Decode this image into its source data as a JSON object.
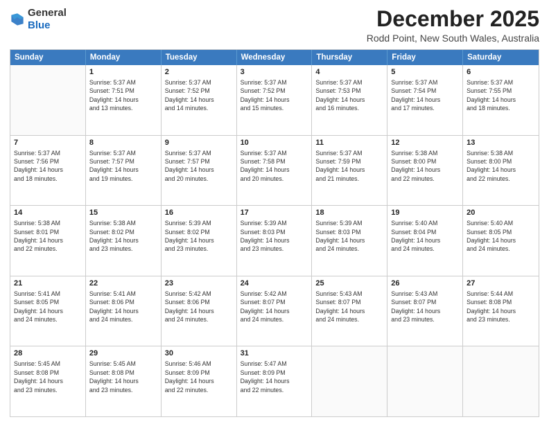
{
  "logo": {
    "general": "General",
    "blue": "Blue"
  },
  "header": {
    "month": "December 2025",
    "location": "Rodd Point, New South Wales, Australia"
  },
  "days": [
    "Sunday",
    "Monday",
    "Tuesday",
    "Wednesday",
    "Thursday",
    "Friday",
    "Saturday"
  ],
  "weeks": [
    [
      {
        "day": "",
        "content": ""
      },
      {
        "day": "1",
        "content": "Sunrise: 5:37 AM\nSunset: 7:51 PM\nDaylight: 14 hours\nand 13 minutes."
      },
      {
        "day": "2",
        "content": "Sunrise: 5:37 AM\nSunset: 7:52 PM\nDaylight: 14 hours\nand 14 minutes."
      },
      {
        "day": "3",
        "content": "Sunrise: 5:37 AM\nSunset: 7:52 PM\nDaylight: 14 hours\nand 15 minutes."
      },
      {
        "day": "4",
        "content": "Sunrise: 5:37 AM\nSunset: 7:53 PM\nDaylight: 14 hours\nand 16 minutes."
      },
      {
        "day": "5",
        "content": "Sunrise: 5:37 AM\nSunset: 7:54 PM\nDaylight: 14 hours\nand 17 minutes."
      },
      {
        "day": "6",
        "content": "Sunrise: 5:37 AM\nSunset: 7:55 PM\nDaylight: 14 hours\nand 18 minutes."
      }
    ],
    [
      {
        "day": "7",
        "content": "Sunrise: 5:37 AM\nSunset: 7:56 PM\nDaylight: 14 hours\nand 18 minutes."
      },
      {
        "day": "8",
        "content": "Sunrise: 5:37 AM\nSunset: 7:57 PM\nDaylight: 14 hours\nand 19 minutes."
      },
      {
        "day": "9",
        "content": "Sunrise: 5:37 AM\nSunset: 7:57 PM\nDaylight: 14 hours\nand 20 minutes."
      },
      {
        "day": "10",
        "content": "Sunrise: 5:37 AM\nSunset: 7:58 PM\nDaylight: 14 hours\nand 20 minutes."
      },
      {
        "day": "11",
        "content": "Sunrise: 5:37 AM\nSunset: 7:59 PM\nDaylight: 14 hours\nand 21 minutes."
      },
      {
        "day": "12",
        "content": "Sunrise: 5:38 AM\nSunset: 8:00 PM\nDaylight: 14 hours\nand 22 minutes."
      },
      {
        "day": "13",
        "content": "Sunrise: 5:38 AM\nSunset: 8:00 PM\nDaylight: 14 hours\nand 22 minutes."
      }
    ],
    [
      {
        "day": "14",
        "content": "Sunrise: 5:38 AM\nSunset: 8:01 PM\nDaylight: 14 hours\nand 22 minutes."
      },
      {
        "day": "15",
        "content": "Sunrise: 5:38 AM\nSunset: 8:02 PM\nDaylight: 14 hours\nand 23 minutes."
      },
      {
        "day": "16",
        "content": "Sunrise: 5:39 AM\nSunset: 8:02 PM\nDaylight: 14 hours\nand 23 minutes."
      },
      {
        "day": "17",
        "content": "Sunrise: 5:39 AM\nSunset: 8:03 PM\nDaylight: 14 hours\nand 23 minutes."
      },
      {
        "day": "18",
        "content": "Sunrise: 5:39 AM\nSunset: 8:03 PM\nDaylight: 14 hours\nand 24 minutes."
      },
      {
        "day": "19",
        "content": "Sunrise: 5:40 AM\nSunset: 8:04 PM\nDaylight: 14 hours\nand 24 minutes."
      },
      {
        "day": "20",
        "content": "Sunrise: 5:40 AM\nSunset: 8:05 PM\nDaylight: 14 hours\nand 24 minutes."
      }
    ],
    [
      {
        "day": "21",
        "content": "Sunrise: 5:41 AM\nSunset: 8:05 PM\nDaylight: 14 hours\nand 24 minutes."
      },
      {
        "day": "22",
        "content": "Sunrise: 5:41 AM\nSunset: 8:06 PM\nDaylight: 14 hours\nand 24 minutes."
      },
      {
        "day": "23",
        "content": "Sunrise: 5:42 AM\nSunset: 8:06 PM\nDaylight: 14 hours\nand 24 minutes."
      },
      {
        "day": "24",
        "content": "Sunrise: 5:42 AM\nSunset: 8:07 PM\nDaylight: 14 hours\nand 24 minutes."
      },
      {
        "day": "25",
        "content": "Sunrise: 5:43 AM\nSunset: 8:07 PM\nDaylight: 14 hours\nand 24 minutes."
      },
      {
        "day": "26",
        "content": "Sunrise: 5:43 AM\nSunset: 8:07 PM\nDaylight: 14 hours\nand 23 minutes."
      },
      {
        "day": "27",
        "content": "Sunrise: 5:44 AM\nSunset: 8:08 PM\nDaylight: 14 hours\nand 23 minutes."
      }
    ],
    [
      {
        "day": "28",
        "content": "Sunrise: 5:45 AM\nSunset: 8:08 PM\nDaylight: 14 hours\nand 23 minutes."
      },
      {
        "day": "29",
        "content": "Sunrise: 5:45 AM\nSunset: 8:08 PM\nDaylight: 14 hours\nand 23 minutes."
      },
      {
        "day": "30",
        "content": "Sunrise: 5:46 AM\nSunset: 8:09 PM\nDaylight: 14 hours\nand 22 minutes."
      },
      {
        "day": "31",
        "content": "Sunrise: 5:47 AM\nSunset: 8:09 PM\nDaylight: 14 hours\nand 22 minutes."
      },
      {
        "day": "",
        "content": ""
      },
      {
        "day": "",
        "content": ""
      },
      {
        "day": "",
        "content": ""
      }
    ]
  ]
}
